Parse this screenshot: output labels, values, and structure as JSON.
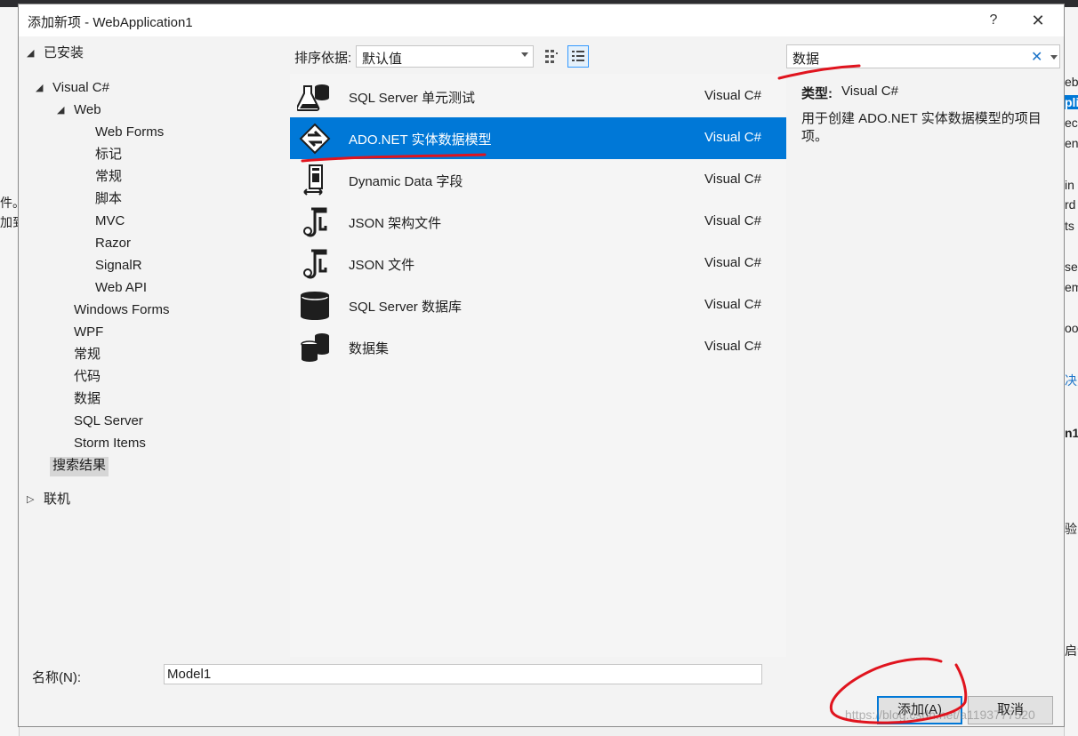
{
  "background": {
    "left_fragments": [
      "件。",
      "加到"
    ],
    "right_fragments": [
      "eb",
      "pli",
      "ec",
      "en",
      "in",
      "rd",
      "ts",
      "ser",
      "em",
      "oo",
      "决方",
      "n1",
      "验",
      "启动"
    ]
  },
  "dialog": {
    "title": "添加新项 - WebApplication1",
    "help_label": "?",
    "close_label": "✕"
  },
  "tree": {
    "installed": "已安装",
    "visual_csharp": "Visual C#",
    "web": "Web",
    "web_children": [
      "Web Forms",
      "标记",
      "常规",
      "脚本",
      "MVC",
      "Razor",
      "SignalR",
      "Web API"
    ],
    "csharp_children": [
      "Windows Forms",
      "WPF",
      "常规",
      "代码",
      "数据",
      "SQL Server",
      "Storm Items"
    ],
    "search_results": "搜索结果",
    "online": "联机"
  },
  "toolbar": {
    "sort_label": "排序依据:",
    "sort_value": "默认值"
  },
  "templates": [
    {
      "name": "SQL Server 单元测试",
      "lang": "Visual C#",
      "icon": "flask-database-icon"
    },
    {
      "name": "ADO.NET 实体数据模型",
      "lang": "Visual C#",
      "icon": "entity-model-icon"
    },
    {
      "name": "Dynamic Data 字段",
      "lang": "Visual C#",
      "icon": "dynamic-data-field-icon"
    },
    {
      "name": "JSON 架构文件",
      "lang": "Visual C#",
      "icon": "json-schema-icon"
    },
    {
      "name": "JSON 文件",
      "lang": "Visual C#",
      "icon": "json-file-icon"
    },
    {
      "name": "SQL Server 数据库",
      "lang": "Visual C#",
      "icon": "database-icon"
    },
    {
      "name": "数据集",
      "lang": "Visual C#",
      "icon": "dataset-icon"
    }
  ],
  "selected_index": 1,
  "search": {
    "value": "数据",
    "clear_label": "✕"
  },
  "details": {
    "type_label": "类型:",
    "type_value": "Visual C#",
    "description": "用于创建 ADO.NET 实体数据模型的项目项。"
  },
  "name_field": {
    "label": "名称(N):",
    "value": "Model1"
  },
  "buttons": {
    "add": "添加(A)",
    "cancel": "取消"
  },
  "watermark": "https://blog.csdn.net/a1193777520",
  "colors": {
    "selection": "#0078d7",
    "annotation": "#e0141e"
  }
}
